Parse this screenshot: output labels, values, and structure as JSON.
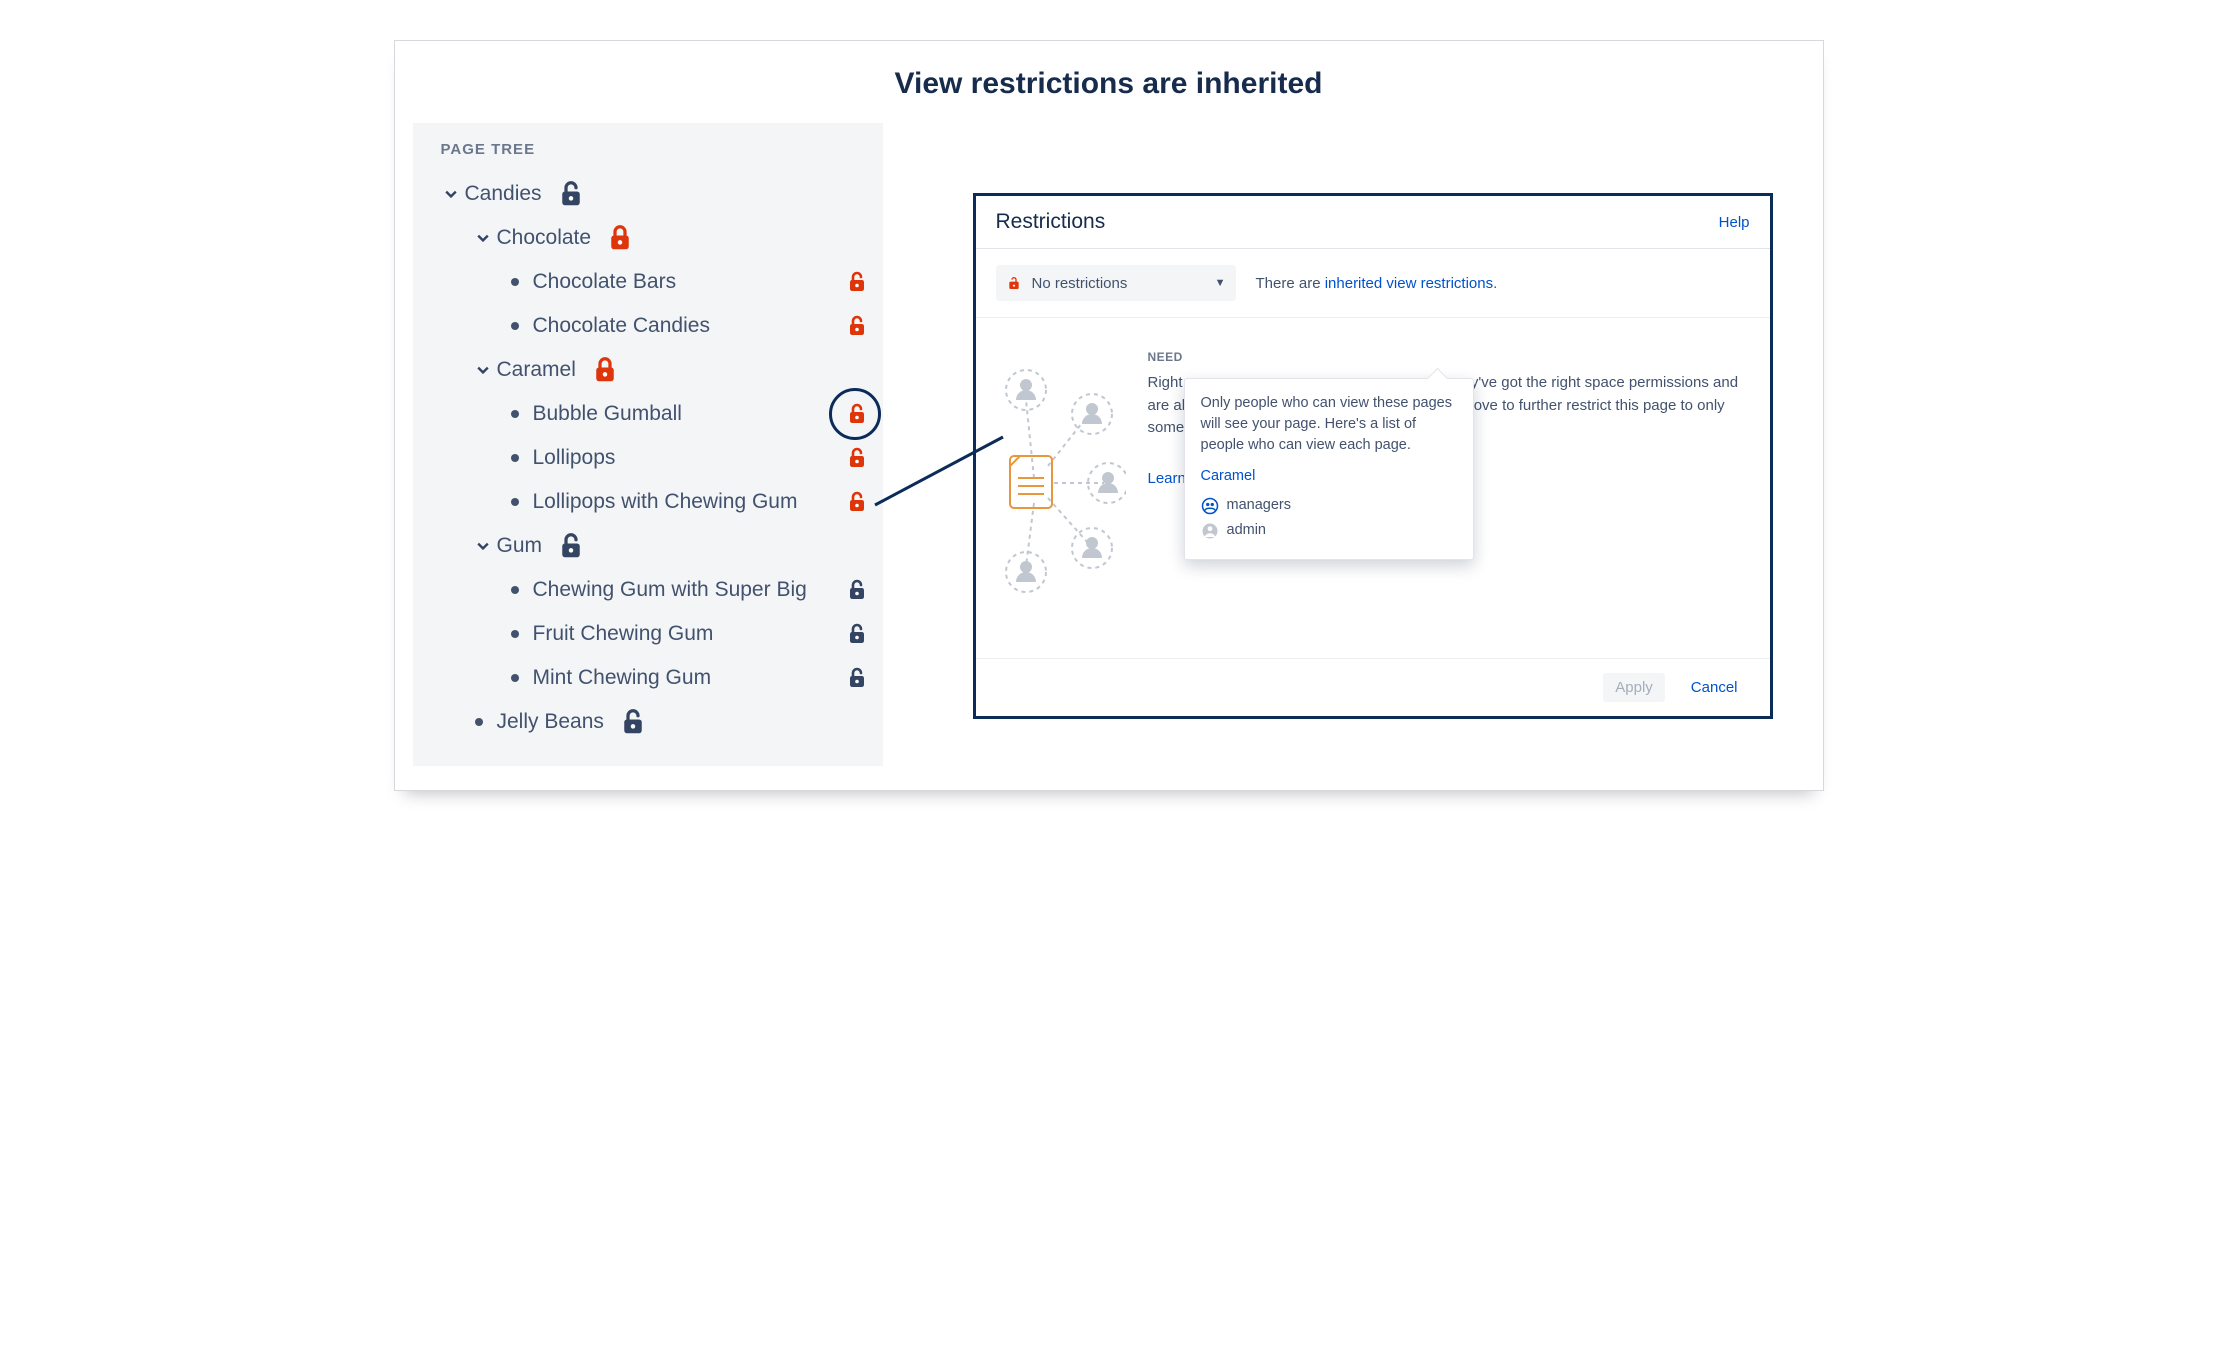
{
  "title": "View restrictions are inherited",
  "sidebar": {
    "heading": "PAGE TREE",
    "items": [
      {
        "label": "Candies",
        "level": 0,
        "expander": "chevron",
        "lock": "navy",
        "lockPos": "after"
      },
      {
        "label": "Chocolate",
        "level": 1,
        "expander": "chevron",
        "lock": "red-locked",
        "lockPos": "after"
      },
      {
        "label": "Chocolate Bars",
        "level": 2,
        "expander": "bullet",
        "lock": "red",
        "lockPos": "right"
      },
      {
        "label": "Chocolate Candies",
        "level": 2,
        "expander": "bullet",
        "lock": "red",
        "lockPos": "right"
      },
      {
        "label": "Caramel",
        "level": 1,
        "expander": "chevron",
        "lock": "red-locked",
        "lockPos": "after"
      },
      {
        "label": "Bubble Gumball",
        "level": 2,
        "expander": "bullet",
        "lock": "red",
        "lockPos": "right",
        "circled": true
      },
      {
        "label": "Lollipops",
        "level": 2,
        "expander": "bullet",
        "lock": "red",
        "lockPos": "right"
      },
      {
        "label": "Lollipops with Chewing Gum",
        "level": 2,
        "expander": "bullet",
        "lock": "red",
        "lockPos": "right"
      },
      {
        "label": "Gum",
        "level": 1,
        "expander": "chevron",
        "lock": "navy",
        "lockPos": "after"
      },
      {
        "label": "Chewing Gum with Super Big",
        "level": 2,
        "expander": "bullet",
        "lock": "navy",
        "lockPos": "right"
      },
      {
        "label": "Fruit Chewing Gum",
        "level": 2,
        "expander": "bullet",
        "lock": "navy",
        "lockPos": "right"
      },
      {
        "label": "Mint Chewing Gum",
        "level": 2,
        "expander": "bullet",
        "lock": "navy",
        "lockPos": "right"
      },
      {
        "label": "Jelly Beans",
        "level": 1,
        "expander": "bullet",
        "lock": "navy",
        "lockPos": "after"
      }
    ]
  },
  "dialog": {
    "title": "Restrictions",
    "help_label": "Help",
    "dropdown_value": "No restrictions",
    "info_prefix": "There are ",
    "info_link": "inherited view restrictions",
    "info_suffix": ".",
    "need_heading": "NEED",
    "body_line1_a": "Right",
    "body_line1_b": "ey've got the right space permissions and",
    "body_line2_a": "are al",
    "body_line2_b": "above to further restrict this page to only",
    "body_line3": "some",
    "learn_more": "Learn more about restrictions",
    "apply_label": "Apply",
    "cancel_label": "Cancel"
  },
  "tooltip": {
    "text": "Only people who can view these pages will see your page. Here's a list of people who can view each page.",
    "page_link": "Caramel",
    "group": "managers",
    "user": "admin"
  },
  "colors": {
    "navy": "#344563",
    "red": "#de350b",
    "link": "#0052cc"
  }
}
